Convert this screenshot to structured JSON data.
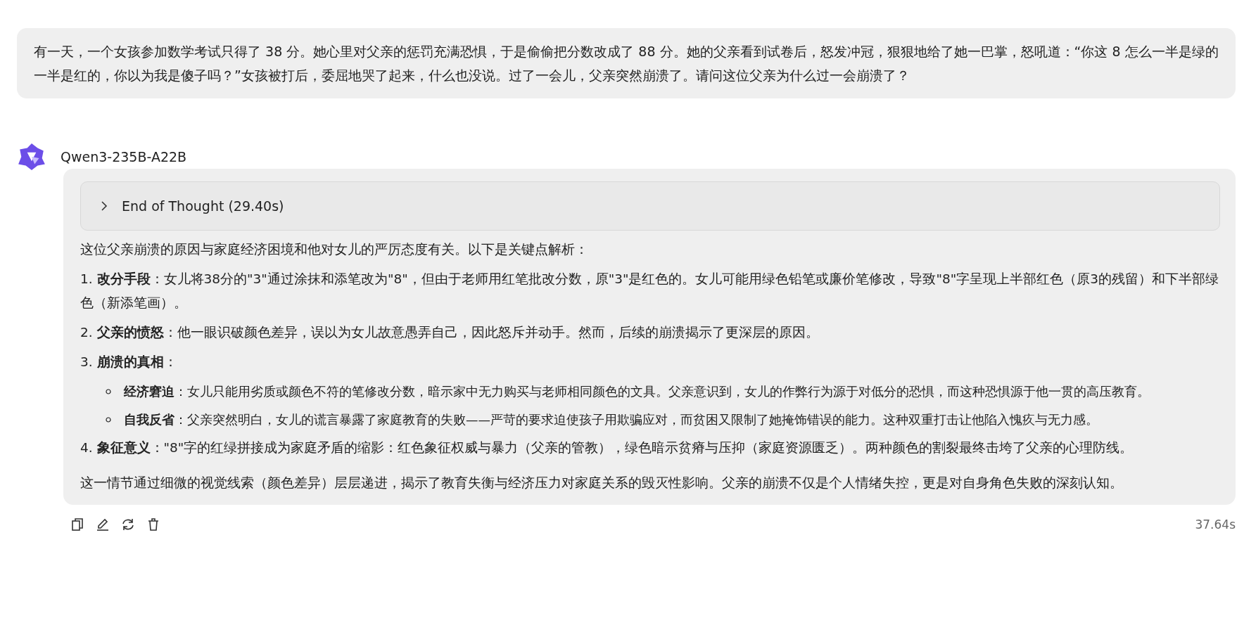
{
  "user_message": {
    "text": "有一天，一个女孩参加数学考试只得了 38 分。她心里对父亲的惩罚充满恐惧，于是偷偷把分数改成了 88 分。她的父亲看到试卷后，怒发冲冠，狠狠地给了她一巴掌，怒吼道：“你这 8 怎么一半是绿的一半是红的，你以为我是傻子吗？”女孩被打后，委屈地哭了起来，什么也没说。过了一会儿，父亲突然崩溃了。请问这位父亲为什么过一会崩溃了？"
  },
  "assistant": {
    "model_name": "Qwen3-235B-A22B",
    "thought": {
      "label": "End of Thought (29.40s)",
      "expanded": false
    },
    "answer": [
      {
        "kind": "paragraph",
        "text": "这位父亲崩溃的原因与家庭经济困境和他对女儿的严厉态度有关。以下是关键点解析："
      },
      {
        "kind": "item",
        "text": "1. **改分手段**：女儿将38分的\"3\"通过涂抹和添笔改为\"8\"，但由于老师用红笔批改分数，原\"3\"是红色的。女儿可能用绿色铅笔或廉价笔修改，导致\"8\"字呈现上半部红色（原3的残留）和下半部绿色（新添笔画）。"
      },
      {
        "kind": "item",
        "text": "2. **父亲的愤怒**：他一眼识破颜色差异，误以为女儿故意愚弄自己，因此怒斥并动手。然而，后续的崩溃揭示了更深层的原因。"
      },
      {
        "kind": "item",
        "text": "3. **崩溃的真相**：",
        "children": [
          {
            "text": "**经济窘迫**：女儿只能用劣质或颜色不符的笔修改分数，暗示家中无力购买与老师相同颜色的文具。父亲意识到，女儿的作弊行为源于对低分的恐惧，而这种恐惧源于他一贯的高压教育。"
          },
          {
            "text": "**自我反省**：父亲突然明白，女儿的谎言暴露了家庭教育的失败——严苛的要求迫使孩子用欺骗应对，而贫困又限制了她掩饰错误的能力。这种双重打击让他陷入愧疚与无力感。"
          }
        ]
      },
      {
        "kind": "item",
        "text": "4. **象征意义**：\"8\"字的红绿拼接成为家庭矛盾的缩影：红色象征权威与暴力（父亲的管教），绿色暗示贫瘠与压抑（家庭资源匮乏）。两种颜色的割裂最终击垮了父亲的心理防线。"
      },
      {
        "kind": "paragraph",
        "text": "这一情节通过细微的视觉线索（颜色差异）层层递进，揭示了教育失衡与经济压力对家庭关系的毁灭性影响。父亲的崩溃不仅是个人情绪失控，更是对自身角色失败的深刻认知。"
      }
    ],
    "actions": [
      {
        "kind": "copy"
      },
      {
        "kind": "edit"
      },
      {
        "kind": "regenerate"
      },
      {
        "kind": "delete"
      }
    ],
    "elapsed": "37.64s"
  }
}
